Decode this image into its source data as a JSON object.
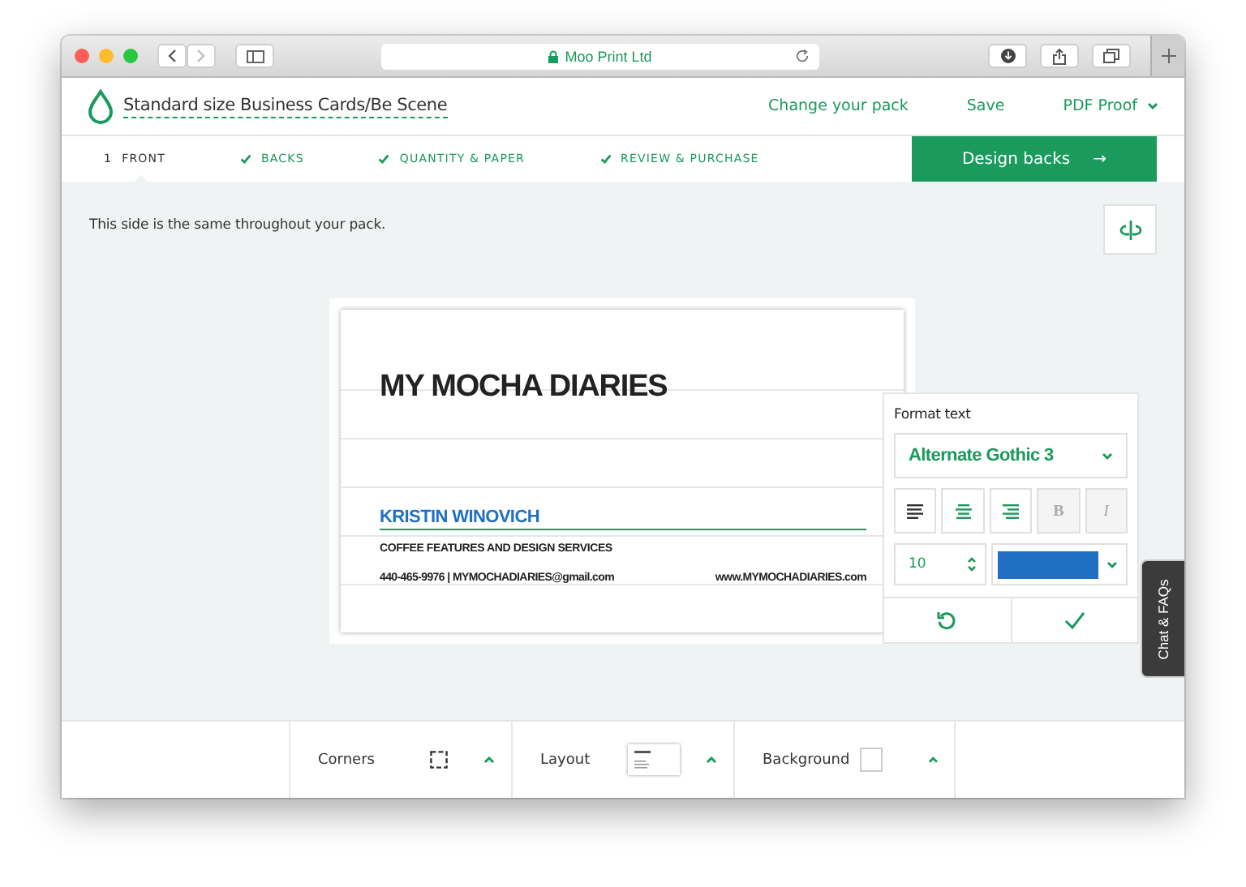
{
  "browser": {
    "address": "Moo Print Ltd"
  },
  "header": {
    "title": "Standard size Business Cards/Be Scene",
    "links": [
      {
        "label": "Change your pack",
        "kind": "link"
      },
      {
        "label": "Save",
        "kind": "link"
      },
      {
        "label": "PDF Proof",
        "kind": "dropdown"
      }
    ]
  },
  "steps": [
    {
      "number": "1",
      "label": "FRONT",
      "selected": true,
      "done": false
    },
    {
      "label": "BACKS",
      "selected": false,
      "done": true
    },
    {
      "label": "QUANTITY & PAPER",
      "selected": false,
      "done": true
    },
    {
      "label": "REVIEW & PURCHASE",
      "selected": false,
      "done": true
    }
  ],
  "primary_button": {
    "label": "Design backs",
    "icon": "→"
  },
  "note": "This side is the same throughout your pack.",
  "card": {
    "title": "MY MOCHA DIARIES",
    "name": "KRISTIN WINOVICH",
    "name_selected": true,
    "tagline": "COFFEE FEATURES AND DESIGN SERVICES",
    "contact": "440-465-9976 | MYMOCHADIARIES@gmail.com",
    "website": "www.MYMOCHADIARIES.com"
  },
  "format_panel": {
    "title": "Format text",
    "font": "Alternate Gothic 3",
    "align": [
      {
        "kind": "left",
        "selected": true
      },
      {
        "kind": "center",
        "selected": false
      },
      {
        "kind": "right",
        "selected": false
      }
    ],
    "styles": [
      {
        "label": "B",
        "kind": "bold",
        "disabled": true
      },
      {
        "label": "I",
        "kind": "italic",
        "disabled": true
      }
    ],
    "size": "10",
    "color": "#1f6fc5"
  },
  "chat_tab": "Chat & FAQs",
  "bottom_bar": [
    {
      "label": "Corners",
      "kind": "corners"
    },
    {
      "label": "Layout",
      "kind": "layout"
    },
    {
      "label": "Background",
      "kind": "background"
    }
  ]
}
